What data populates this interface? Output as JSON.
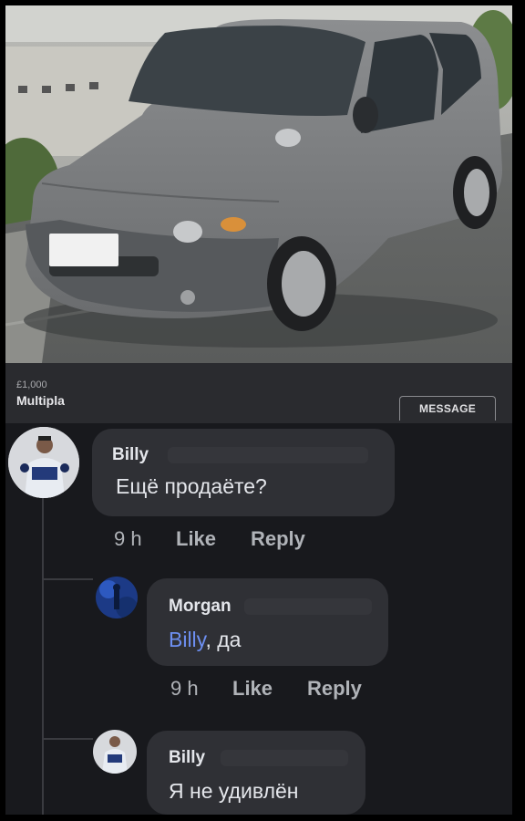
{
  "listing": {
    "price": "£1,000",
    "title": "Multipla",
    "message_button": "MESSAGE"
  },
  "comments": [
    {
      "author": "Billy",
      "text": "Ещё продаёте?",
      "time": "9 h",
      "like": "Like",
      "reply": "Reply"
    },
    {
      "author": "Morgan",
      "mention": "Billy",
      "text": ", да",
      "time": "9 h",
      "like": "Like",
      "reply": "Reply"
    },
    {
      "author": "Billy",
      "text": "Я не удивлён"
    }
  ],
  "colors": {
    "mention": "#6d8ff0",
    "bubble": "#2f3035",
    "background": "#18191d"
  }
}
